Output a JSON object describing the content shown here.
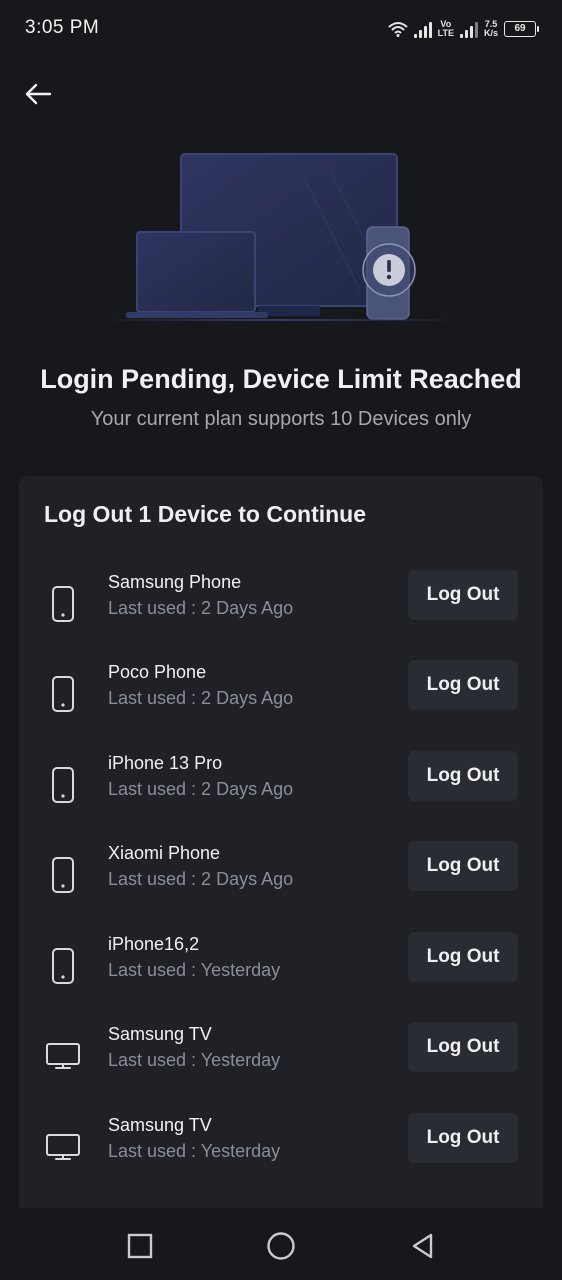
{
  "status_bar": {
    "time": "3:05 PM",
    "network_label_top": "Vo",
    "network_label_bottom": "LTE",
    "speed_value": "7.5",
    "speed_unit": "K/s",
    "battery": "69"
  },
  "header": {
    "back_icon": "arrow-left-icon"
  },
  "hero": {
    "illustration": "devices-illustration",
    "badge_icon": "exclamation-icon"
  },
  "page": {
    "title": "Login Pending, Device Limit Reached",
    "subtitle": "Your current plan supports 10 Devices only"
  },
  "card": {
    "title": "Log Out 1 Device to Continue",
    "logout_label": "Log Out",
    "devices": [
      {
        "type": "phone",
        "name": "Samsung Phone",
        "last_used": "Last used : 2 Days Ago"
      },
      {
        "type": "phone",
        "name": "Poco Phone",
        "last_used": "Last used : 2 Days Ago"
      },
      {
        "type": "phone",
        "name": "iPhone 13 Pro",
        "last_used": "Last used : 2 Days Ago"
      },
      {
        "type": "phone",
        "name": "Xiaomi Phone",
        "last_used": "Last used : 2 Days Ago"
      },
      {
        "type": "phone",
        "name": "iPhone16,2",
        "last_used": "Last used : Yesterday"
      },
      {
        "type": "tv",
        "name": "Samsung TV",
        "last_used": "Last used : Yesterday"
      },
      {
        "type": "tv",
        "name": "Samsung TV",
        "last_used": "Last used : Yesterday"
      }
    ]
  },
  "nav": {
    "recents_icon": "square-icon",
    "home_icon": "circle-icon",
    "back_icon": "triangle-back-icon"
  },
  "colors": {
    "background": "#17181c",
    "card": "#1f2127",
    "button": "#2a2c33",
    "muted_text": "#8a8e99"
  }
}
